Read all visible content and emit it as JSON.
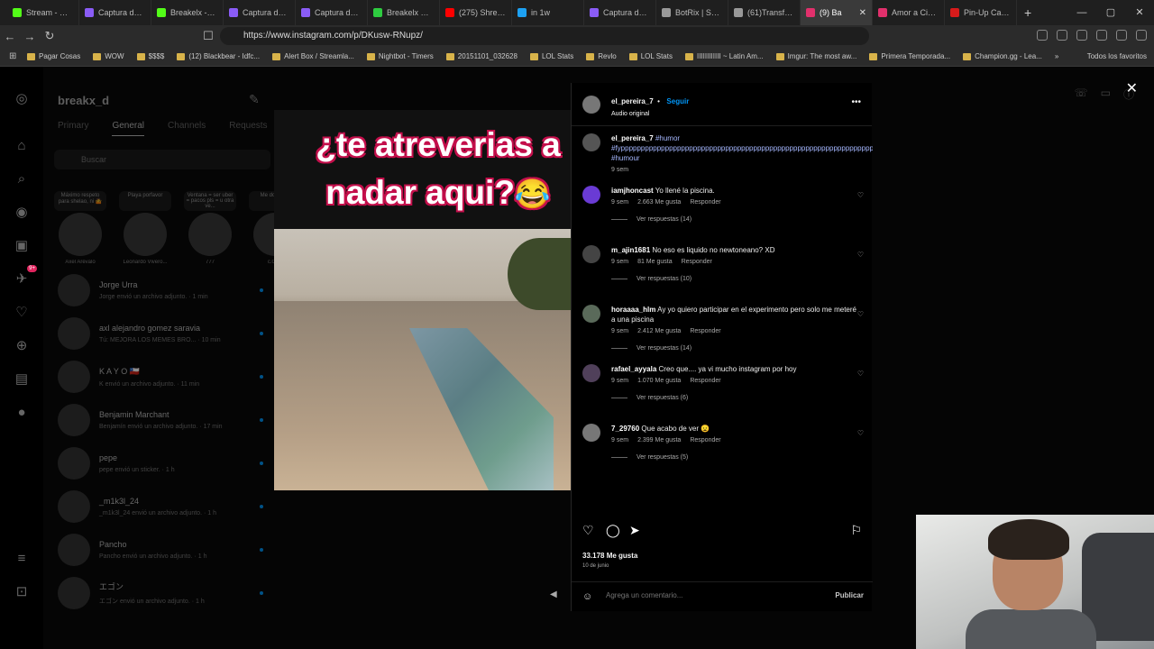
{
  "browser": {
    "tabs": [
      {
        "label": "Stream - Kick",
        "color": "#53fc18"
      },
      {
        "label": "Captura de p",
        "color": "#8a5cf6"
      },
      {
        "label": "Breakelx - We",
        "color": "#53fc18"
      },
      {
        "label": "Captura de p",
        "color": "#8a5cf6"
      },
      {
        "label": "Captura de p",
        "color": "#8a5cf6"
      },
      {
        "label": "Breakelx Stre",
        "color": "#2ecc40"
      },
      {
        "label": "(275) Shrek 2",
        "color": "#ff0000"
      },
      {
        "label": "in 1w",
        "color": "#1da1f2"
      },
      {
        "label": "Captura de p",
        "color": "#8a5cf6"
      },
      {
        "label": "BotRix | Sorte",
        "color": "#999999"
      },
      {
        "label": "(61)Transform",
        "color": "#999999"
      },
      {
        "label": "(9) Ba",
        "color": "#e1306c",
        "active": true
      },
      {
        "label": "Amor a Ciegas",
        "color": "#e1306c"
      },
      {
        "label": "Pin-Up Casin",
        "color": "#d81b1b"
      }
    ],
    "new_tab": "+",
    "url": "https://www.instagram.com/p/DKusw-RNupz/",
    "bookmarks": [
      "Pagar Cosas",
      "WOW",
      "$$$$",
      "(12) Blackbear - Idfc...",
      "Alert Box / Streamla...",
      "Nightbot - Timers",
      "20151101_032628",
      "LOL Stats",
      "Revlo",
      "LOL Stats",
      "IIIIIIIIIIII ~ Latin Am...",
      "Imgur: The most aw...",
      "Primera Temporada...",
      "Champion.gg - Lea..."
    ],
    "bookmarks_more": "»",
    "all_bookmarks": "Todos los favoritos"
  },
  "dm": {
    "username": "breakx_d",
    "tabs": [
      "Primary",
      "General",
      "Channels",
      "Requests"
    ],
    "search_placeholder": "Buscar",
    "notes": [
      {
        "bubble": "Máximo respeto para shelao, ni 🤷",
        "name": "Axel Arévalo"
      },
      {
        "bubble": "Playa porfavor",
        "name": "Leonardo Vivero..."
      },
      {
        "bubble": "Ventana = ser uber = pacos pls = u otra ve...",
        "name": "777"
      },
      {
        "bubble": "Me don vida",
        "name": "c.04..."
      }
    ],
    "threads": [
      {
        "name": "Jorge Urra",
        "preview": "Jorge envió un archivo adjunto. · 1 min"
      },
      {
        "name": "axl alejandro gomez saravia",
        "preview": "Tú: MEJORA LOS MEMES BRO... · 10 min"
      },
      {
        "name": "K A Y O 🇨🇱",
        "preview": "K envió un archivo adjunto. · 11 min"
      },
      {
        "name": "Benjamin Marchant",
        "preview": "Benjamín envió un archivo adjunto. · 17 min"
      },
      {
        "name": "pepe",
        "preview": "pepe envió un sticker. · 1 h"
      },
      {
        "name": "_m1k3l_24",
        "preview": "_m1k3l_24 envió un archivo adjunto. · 1 h"
      },
      {
        "name": "Pancho",
        "preview": "Pancho envió un archivo adjunto. · 1 h"
      },
      {
        "name": "エゴン",
        "preview": "エゴン envió un archivo adjunto. · 1 h"
      }
    ]
  },
  "post": {
    "caption_line1": "¿te atreverias a",
    "caption_line2": "nadar aqui?",
    "caption_emoji": "😂",
    "author": "el_pereira_7",
    "follow": "Seguir",
    "audio": "Audio original",
    "description_user": "el_pereira_7",
    "description_tags": "#humor #fyppppppppppppppppppppppppppppppppppppppppppppppppppppppppppppppppppppppppp #humour",
    "description_time": "9 sem",
    "comments": [
      {
        "user": "iamjhoncast",
        "text": "Yo llené la piscina.",
        "time": "9 sem",
        "likes": "2.663 Me gusta",
        "reply": "Responder",
        "replies": "Ver respuestas (14)"
      },
      {
        "user": "m_ajin1681",
        "text": "No eso es liquido no newtoneano? XD",
        "time": "9 sem",
        "likes": "81 Me gusta",
        "reply": "Responder",
        "replies": "Ver respuestas (10)"
      },
      {
        "user": "horaaaa_hlm",
        "text": "Ay yo quiero participar en el experimento pero solo me meteré a una piscina",
        "time": "9 sem",
        "likes": "2.412 Me gusta",
        "reply": "Responder",
        "replies": "Ver respuestas (14)"
      },
      {
        "user": "rafael_ayyala",
        "text": "Creo que.... ya vi mucho instagram por hoy",
        "time": "9 sem",
        "likes": "1.070 Me gusta",
        "reply": "Responder",
        "replies": "Ver respuestas (6)"
      },
      {
        "user": "7_29760",
        "text": "Que acabo de ver 😦",
        "time": "9 sem",
        "likes": "2.399 Me gusta",
        "reply": "Responder",
        "replies": "Ver respuestas (5)"
      }
    ],
    "like_count": "33.178 Me gusta",
    "date": "10 de junio",
    "comment_placeholder": "Agrega un comentario...",
    "publish": "Publicar"
  },
  "icons": {
    "more": "more-horizontal-icon",
    "close": "close-icon",
    "heart": "heart-icon",
    "comment": "comment-icon",
    "share": "share-icon",
    "save": "bookmark-icon",
    "emoji": "emoji-icon",
    "volume": "volume-icon"
  }
}
